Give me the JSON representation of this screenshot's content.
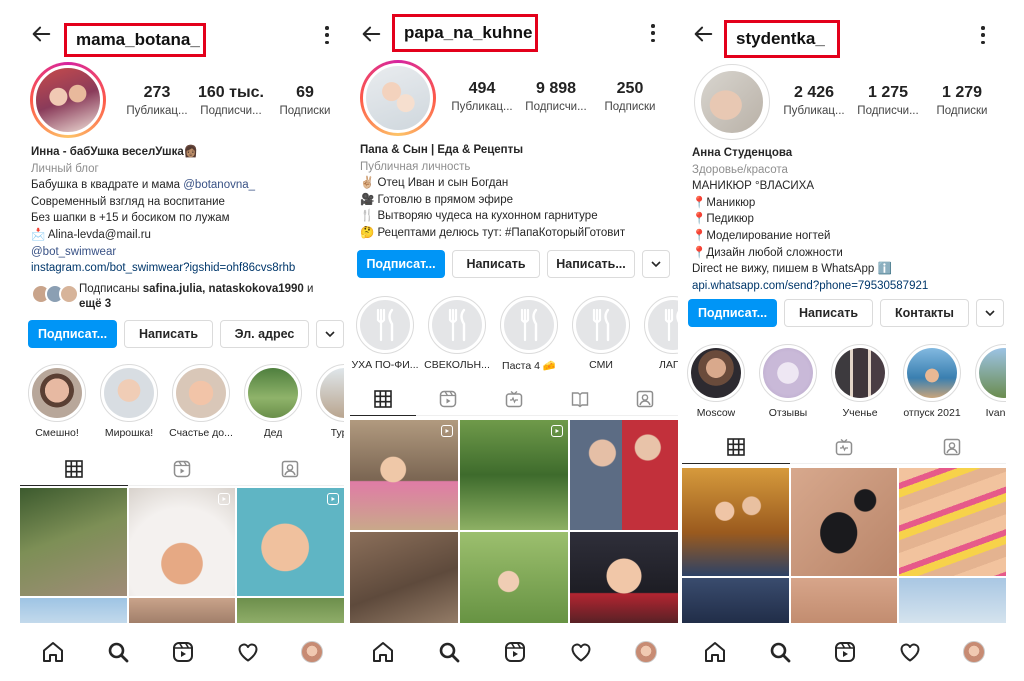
{
  "colors": {
    "primary": "#0095f6",
    "highlight_box": "#e3001b",
    "link": "#00376b"
  },
  "profiles": [
    {
      "username": "mama_botana_",
      "stats": [
        {
          "value": "273",
          "label": "Публикац..."
        },
        {
          "value": "160 тыс.",
          "label": "Подписчи..."
        },
        {
          "value": "69",
          "label": "Подписки"
        }
      ],
      "bio": {
        "name": "Инна  - бабУшка веселУшка👩🏽",
        "category": "Личный блог",
        "line1_prefix": "Бабушка в квадрате и мама ",
        "line1_mention": "@botanovna_",
        "lines": [
          "Современный взгляд на воспитание",
          "Без шапки в +15 и босиком по лужам",
          "📩 Alina-levda@mail.ru"
        ],
        "mention2": "@bot_swimwear",
        "link": "instagram.com/bot_swimwear?igshid=ohf86cvs8rhb"
      },
      "followed": {
        "prefix": "Подписаны ",
        "names": "safina.julia, nataskokova1990",
        "suffix_pre": " и ",
        "suffix": "ещё 3"
      },
      "buttons": [
        "Подписат...",
        "Написать",
        "Эл. адрес"
      ],
      "highlights": [
        "Смешно!",
        "Мирошка!",
        "Счастье до...",
        "Дед",
        "Турци"
      ],
      "tabs": [
        "grid-icon",
        "reels-icon",
        "tagged-icon"
      ]
    },
    {
      "username": "papa_na_kuhne",
      "stats": [
        {
          "value": "494",
          "label": "Публикац..."
        },
        {
          "value": "9 898",
          "label": "Подписчи..."
        },
        {
          "value": "250",
          "label": "Подписки"
        }
      ],
      "bio": {
        "name": "Папа & Сын | Еда & Рецепты",
        "category": "Публичная личность",
        "lines": [
          "✌🏼 Отец Иван и сын Богдан",
          "🎥 Готовлю в прямом эфире",
          "🍴 Вытворяю чудеса на кухонном гарнитуре",
          "🤔 Рецептами делюсь тут: #ПапаКоторыйГотовит"
        ]
      },
      "buttons": [
        "Подписат...",
        "Написать",
        "Написать..."
      ],
      "highlights": [
        "УХА ПО-ФИ...",
        "СВЕКОЛЬН...",
        "Паста 4 🧀",
        "СМИ",
        "ЛАГМ"
      ],
      "tabs": [
        "grid-icon",
        "reels-icon",
        "igtv-icon",
        "guides-icon",
        "tagged-icon"
      ]
    },
    {
      "username": "stydentka_",
      "stats": [
        {
          "value": "2 426",
          "label": "Публикац..."
        },
        {
          "value": "1 275",
          "label": "Подписчи..."
        },
        {
          "value": "1 279",
          "label": "Подписки"
        }
      ],
      "bio": {
        "name": "Анна Студенцова",
        "category": "Здоровье/красота",
        "lines": [
          "МАНИКЮР °ВЛАСИХА",
          "📍Маникюр",
          "📍Педикюр",
          "📍Моделирование ногтей",
          "📍Дизайн любой сложности",
          "Direct не вижу, пишем в WhatsApp ℹ️"
        ],
        "link": "api.whatsapp.com/send?phone=79530587921"
      },
      "buttons": [
        "Подписат...",
        "Написать",
        "Контакты"
      ],
      "highlights": [
        "Moscow",
        "Отзывы",
        "Ученье",
        "отпуск 2021",
        "Ivanovo"
      ],
      "tabs": [
        "grid-icon",
        "reels-icon",
        "tagged-icon"
      ]
    }
  ],
  "bottom_nav": [
    "home-icon",
    "search-icon",
    "reels-icon",
    "heart-icon",
    "profile-avatar"
  ]
}
